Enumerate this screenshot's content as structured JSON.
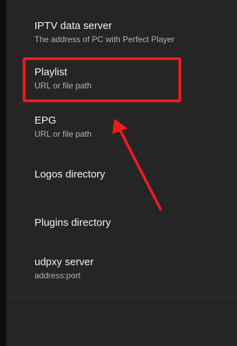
{
  "settings": {
    "items": [
      {
        "title": "IPTV data server",
        "subtitle": "The address of PC with Perfect Player"
      },
      {
        "title": "Playlist",
        "subtitle": "URL or file path"
      },
      {
        "title": "EPG",
        "subtitle": "URL or file path"
      },
      {
        "title": "Logos directory"
      },
      {
        "title": "Plugins directory"
      },
      {
        "title": "udpxy server",
        "subtitle": "address:port"
      }
    ]
  },
  "annotation": {
    "color": "#ee1c1c"
  },
  "colors": {
    "background": "#252525",
    "title": "#f2f2f2",
    "subtitle": "#b3b3b3"
  }
}
